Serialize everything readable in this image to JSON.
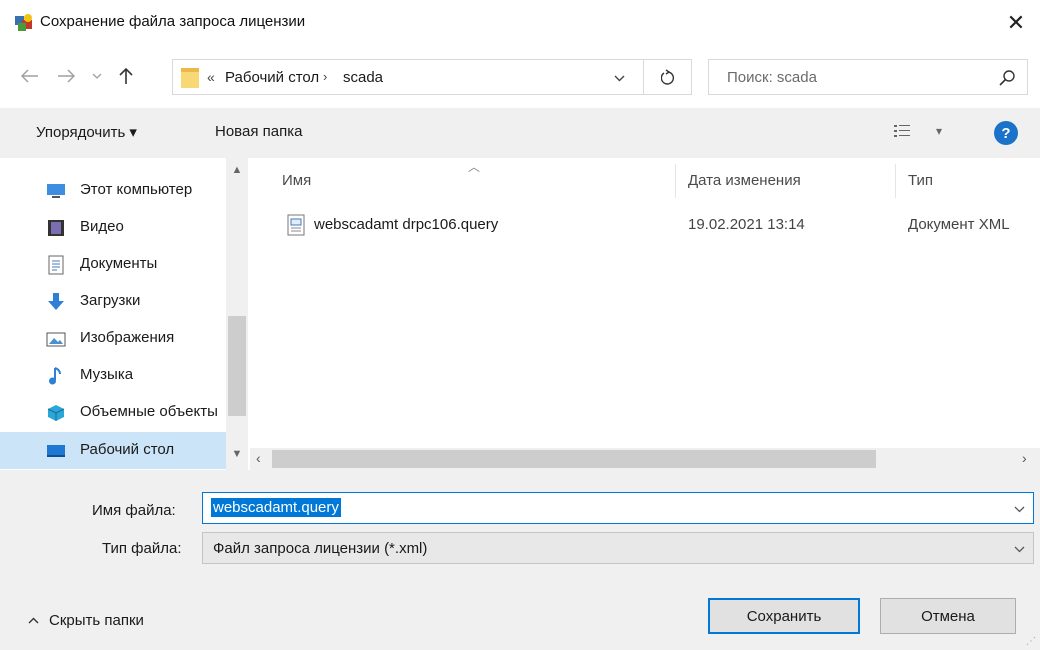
{
  "window": {
    "title": "Сохранение файла запроса лицензии",
    "close_label": "✕"
  },
  "nav": {
    "back_icon": "arrow-left-icon",
    "forward_icon": "arrow-right-icon",
    "up_icon": "arrow-up-icon",
    "address": {
      "prefix": "«",
      "path": [
        "Рабочий стол",
        "scada"
      ],
      "separator": "›"
    },
    "search_placeholder": "Поиск: scada"
  },
  "command_bar": {
    "organize_label": "Упорядочить ▾",
    "new_folder_label": "Новая папка",
    "view_label": "▾",
    "help_label": "?"
  },
  "sidebar": {
    "items": [
      {
        "label": "Этот компьютер",
        "icon": "computer-icon",
        "selected": false
      },
      {
        "label": "Видео",
        "icon": "video-icon",
        "selected": false
      },
      {
        "label": "Документы",
        "icon": "documents-icon",
        "selected": false
      },
      {
        "label": "Загрузки",
        "icon": "downloads-icon",
        "selected": false
      },
      {
        "label": "Изображения",
        "icon": "pictures-icon",
        "selected": false
      },
      {
        "label": "Музыка",
        "icon": "music-icon",
        "selected": false
      },
      {
        "label": "Объемные объекты",
        "icon": "3d-objects-icon",
        "selected": false
      },
      {
        "label": "Рабочий стол",
        "icon": "desktop-icon",
        "selected": true
      }
    ]
  },
  "filelist": {
    "columns": [
      "Имя",
      "Дата изменения",
      "Тип"
    ],
    "files": [
      {
        "name": "webscadamt drpc106.query",
        "date": "19.02.2021 13:14",
        "type": "Документ XML"
      }
    ]
  },
  "form": {
    "filename_label": "Имя файла:",
    "filename_value": "webscadamt.query",
    "filetype_label": "Тип файла:",
    "filetype_value": "Файл запроса лицензии (*.xml)"
  },
  "footer": {
    "hide_folders_label": "Скрыть папки",
    "save_label": "Сохранить",
    "cancel_label": "Отмена"
  },
  "colors": {
    "accent": "#0078d7",
    "selection": "#cce4f7",
    "panel": "#f0f0f0"
  }
}
